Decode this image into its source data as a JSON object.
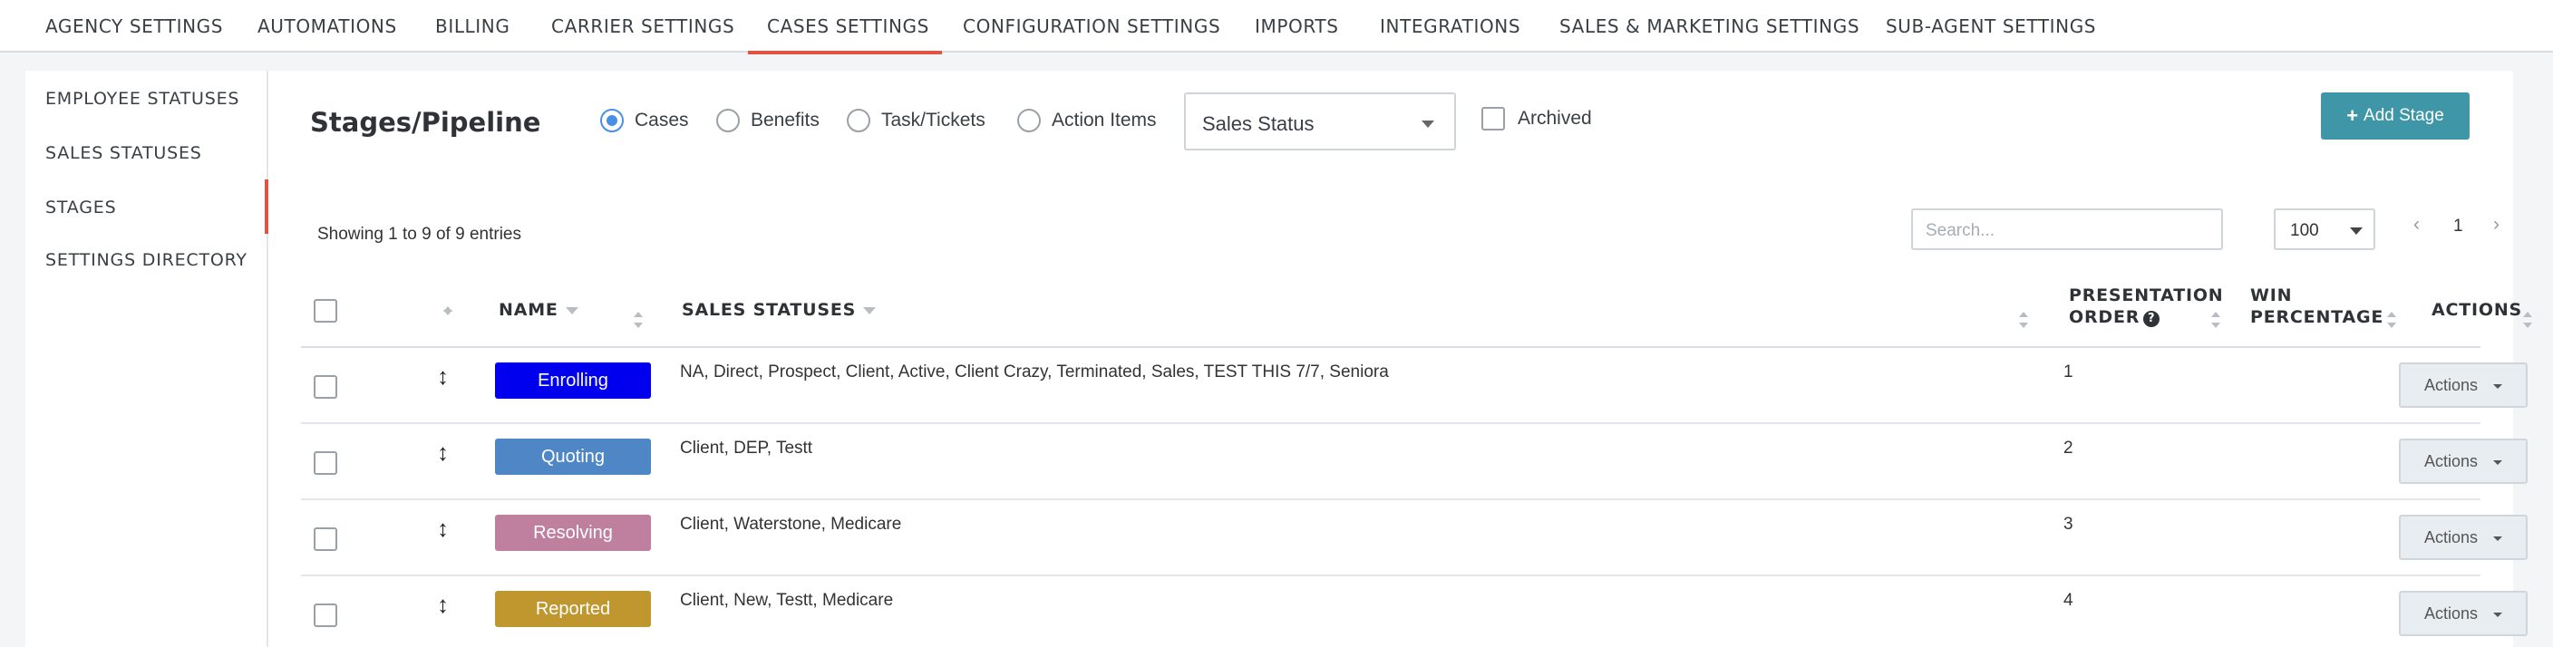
{
  "topnav": {
    "tabs": [
      {
        "label": "AGENCY SETTINGS"
      },
      {
        "label": "AUTOMATIONS"
      },
      {
        "label": "BILLING"
      },
      {
        "label": "CARRIER SETTINGS"
      },
      {
        "label": "CASES SETTINGS",
        "active": true
      },
      {
        "label": "CONFIGURATION SETTINGS"
      },
      {
        "label": "IMPORTS"
      },
      {
        "label": "INTEGRATIONS"
      },
      {
        "label": "SALES & MARKETING SETTINGS"
      },
      {
        "label": "SUB-AGENT SETTINGS"
      }
    ],
    "accent": "#e2543f"
  },
  "sidebar": {
    "items": [
      {
        "label": "EMPLOYEE STATUSES"
      },
      {
        "label": "SALES STATUSES"
      },
      {
        "label": "STAGES",
        "active": true
      },
      {
        "label": "SETTINGS DIRECTORY"
      }
    ]
  },
  "main": {
    "title": "Stages/Pipeline",
    "radios": [
      {
        "label": "Cases",
        "checked": true
      },
      {
        "label": "Benefits",
        "checked": false
      },
      {
        "label": "Task/Tickets",
        "checked": false
      },
      {
        "label": "Action Items",
        "checked": false
      }
    ],
    "status_select": "Sales Status",
    "archived_label": "Archived",
    "add_button": "Add Stage",
    "add_button_color": "#3e96a6",
    "showing": "Showing 1 to 9 of 9 entries",
    "search_placeholder": "Search...",
    "page_size": "100",
    "pager": {
      "prev": "‹",
      "current": "1",
      "next": "›"
    }
  },
  "table": {
    "headers": {
      "name": "NAME",
      "sales_statuses": "SALES STATUSES",
      "presentation_order_1": "PRESENTATION",
      "presentation_order_2": "ORDER",
      "win_percentage_1": "WIN",
      "win_percentage_2": "PERCENTAGE",
      "actions": "ACTIONS"
    },
    "rows": [
      {
        "name": "Enrolling",
        "color": "#0000ee",
        "statuses": "NA, Direct, Prospect, Client, Active, Client Crazy, Terminated, Sales, TEST THIS 7/7, Seniora",
        "order": "1",
        "action": "Actions"
      },
      {
        "name": "Quoting",
        "color": "#4f86c6",
        "statuses": "Client, DEP, Testt",
        "order": "2",
        "action": "Actions"
      },
      {
        "name": "Resolving",
        "color": "#bf809f",
        "statuses": "Client, Waterstone, Medicare",
        "order": "3",
        "action": "Actions"
      },
      {
        "name": "Reported",
        "color": "#c0962e",
        "statuses": "Client, New, Testt, Medicare",
        "order": "4",
        "action": "Actions"
      }
    ]
  }
}
